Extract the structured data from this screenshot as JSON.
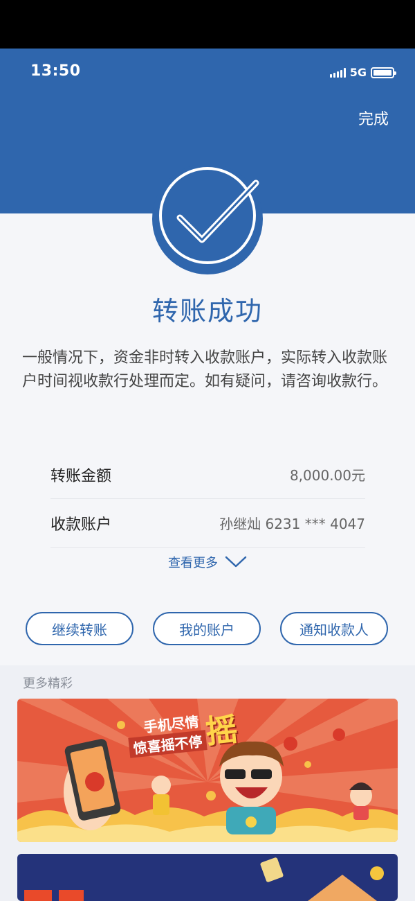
{
  "status_bar": {
    "time": "13:50",
    "network": "5G"
  },
  "header": {
    "done_label": "完成"
  },
  "result": {
    "title": "转账成功",
    "description": "一般情况下，资金非时转入收款账户，实际转入收款账户时间视收款行处理而定。如有疑问，请咨询收款行。"
  },
  "details": {
    "rows": [
      {
        "label": "转账金额",
        "value": "8,000.00元"
      },
      {
        "label": "收款账户",
        "value": "孙继灿 6231 *** 4047"
      }
    ],
    "more_label": "查看更多"
  },
  "actions": {
    "continue_label": "继续转账",
    "my_account_label": "我的账户",
    "notify_label": "通知收款人"
  },
  "promo": {
    "section_title": "更多精彩",
    "banner1_line1": "手机尽情",
    "banner1_line2": "惊喜摇不停",
    "banner1_big": "摇"
  },
  "colors": {
    "brand_blue": "#2f66ad",
    "banner_red": "#e65a3e",
    "banner_navy": "#24337a"
  }
}
